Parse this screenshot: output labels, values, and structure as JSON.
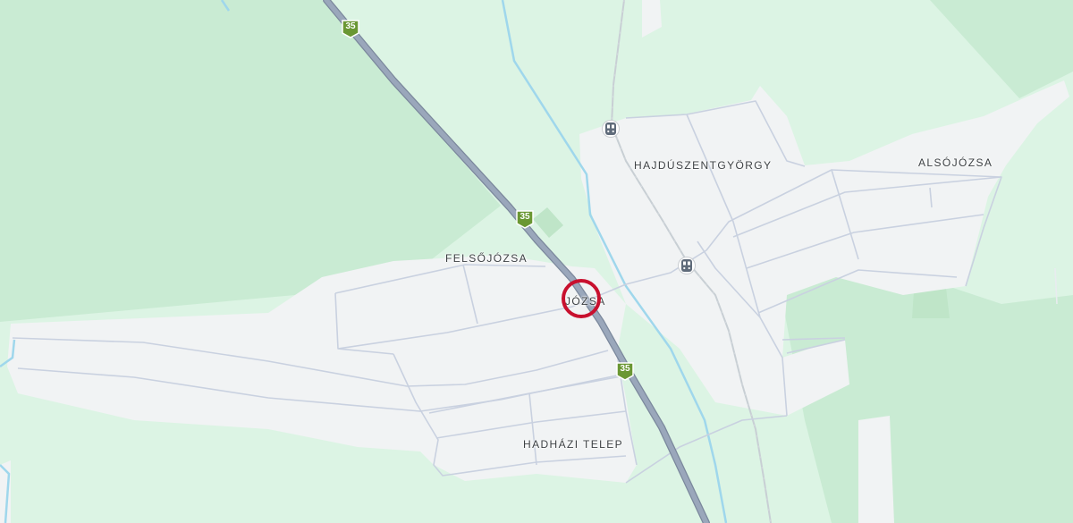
{
  "map": {
    "colors": {
      "land": "#dcf4e4",
      "forest": "#c9ebd3",
      "settlement": "#f1f3f4",
      "minor_road": "#c4ccdc",
      "highway": "#8e9cb1",
      "water": "#9fd7ec",
      "railway": "#c8cfd4",
      "shield": "#7aa33c",
      "marker": "#c8102e"
    },
    "places": {
      "hajduszentgyorgy": "HAJDÚSZENTGYÖRGY",
      "alsojozsa": "ALSÓJÓZSA",
      "felsojozsa": "FELSŐJÓZSA",
      "jozsa": "JÓZSA",
      "hadhazi_telep": "HADHÁZI TELEP"
    },
    "road_shields": [
      "35",
      "35",
      "35"
    ],
    "icons": {
      "station": "train-station-icon",
      "marker": "selected-location-ring-icon"
    }
  }
}
